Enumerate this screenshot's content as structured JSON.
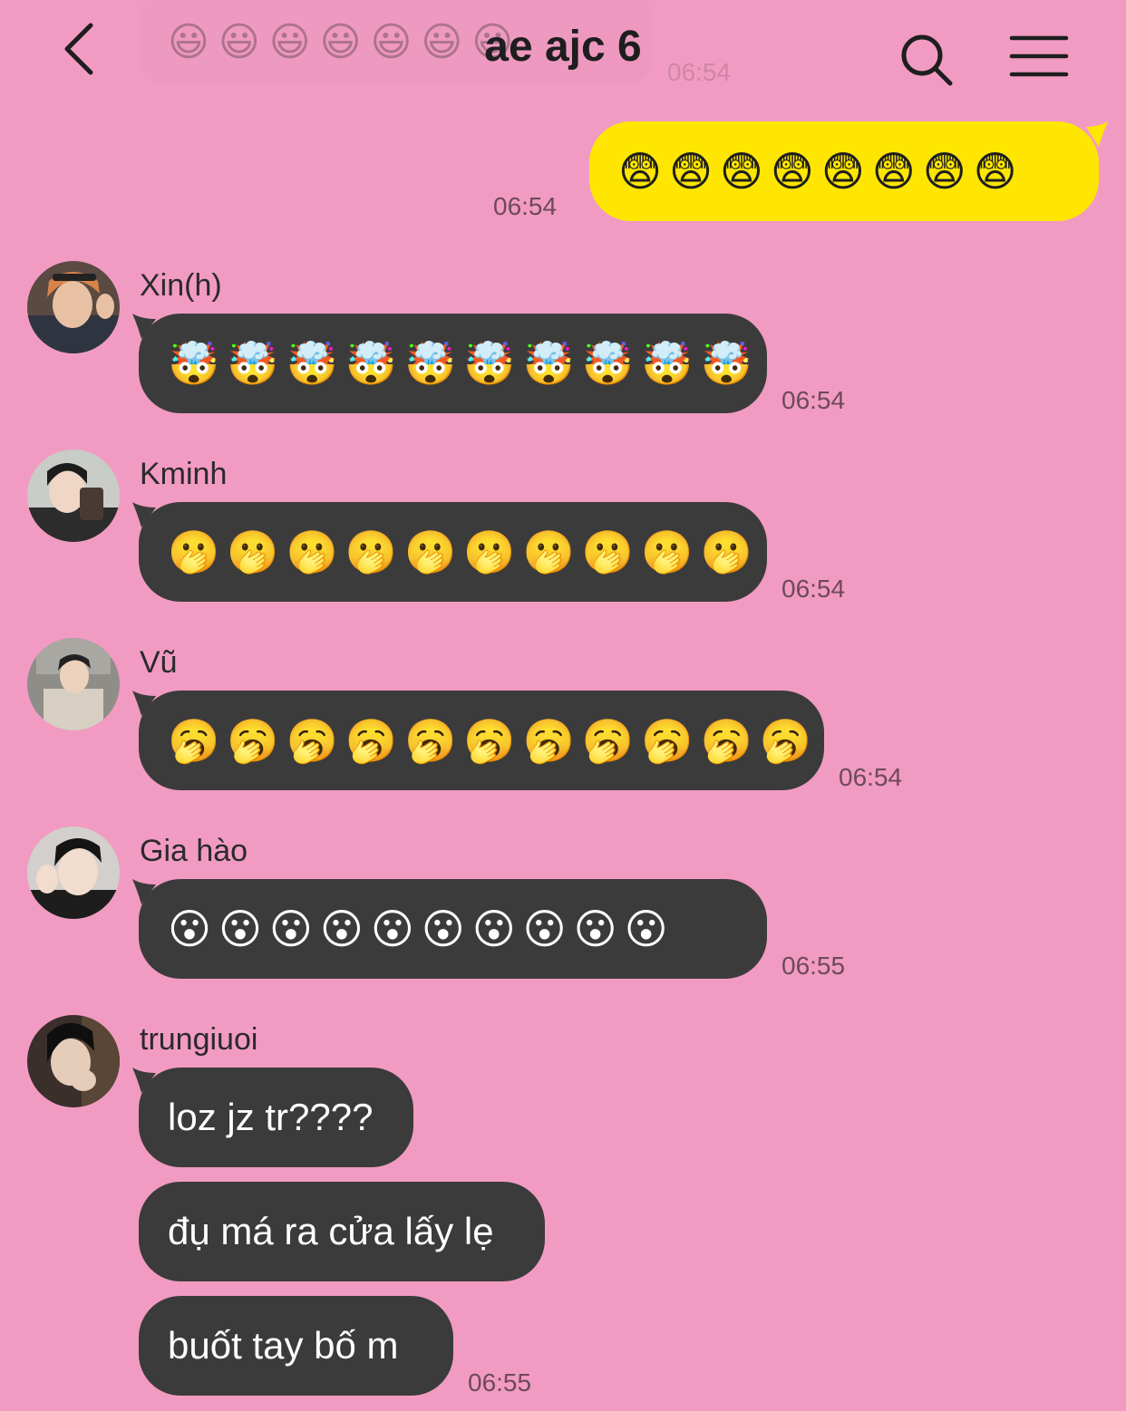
{
  "header": {
    "title": "ae ajc 6",
    "faded_bubble_emojis": "😃😃😃😃😃😃😃",
    "faded_time": "06:54"
  },
  "messages": [
    {
      "mine": true,
      "content": "😨😨😨😨😨😨😨😨",
      "time": "06:54"
    },
    {
      "sender": "Xin(h)",
      "content": "🤯🤯🤯🤯🤯🤯🤯🤯🤯🤯",
      "time": "06:54"
    },
    {
      "sender": "Kminh",
      "content": "🫢🫢🫢🫢🫢🫢🫢🫢🫢🫢",
      "time": "06:54"
    },
    {
      "sender": "Vũ",
      "content": "🥱🥱🥱🥱🥱🥱🥱🥱🥱🥱🥱",
      "time": "06:54"
    },
    {
      "sender": "Gia hào",
      "content": "😮😮😮😮😮😮😮😮😮😮",
      "time": "06:55"
    },
    {
      "sender": "trungiuoi",
      "texts": [
        "loz jz tr????",
        "đụ má ra cửa lấy lẹ",
        "buốt tay bố m"
      ],
      "time": "06:55"
    }
  ]
}
